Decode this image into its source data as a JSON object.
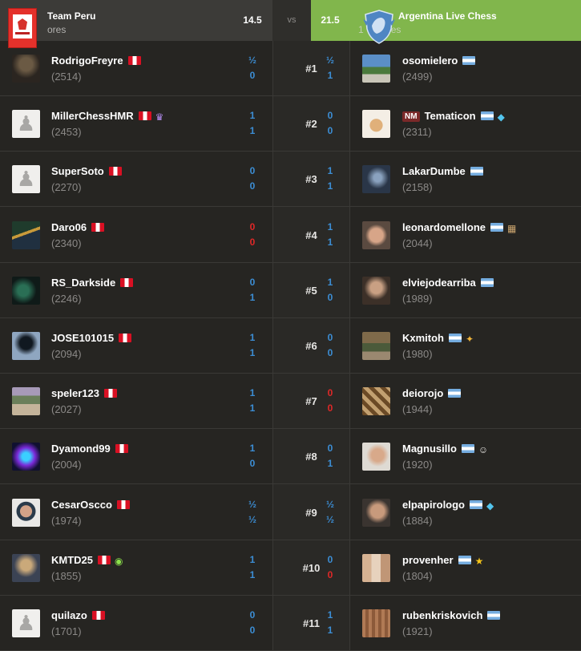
{
  "header": {
    "left_team": "Team Peru",
    "left_sub": "ores",
    "left_score": "14.5",
    "vs": "vs",
    "right_score": "21.5",
    "right_team": "Argentina Live Chess",
    "right_sub": "ores",
    "right_sub_prefix": "1"
  },
  "colors": {
    "win": "#3c8ed5",
    "loss": "#e02828",
    "accent_green": "#81b64c",
    "bg": "#262522"
  },
  "boards": [
    {
      "board": "#1",
      "left": {
        "name": "RodrigoFreyre",
        "rating": "(2514)",
        "avatar": "photo-dark",
        "badges": []
      },
      "left_scores": [
        "½",
        "0"
      ],
      "left_colors": [
        "blue",
        "blue"
      ],
      "right": {
        "name": "osomielero",
        "rating": "(2499)",
        "avatar": "photo-landscape",
        "badges": [],
        "title": ""
      },
      "right_scores": [
        "½",
        "1"
      ],
      "right_colors": [
        "blue",
        "blue"
      ]
    },
    {
      "board": "#2",
      "left": {
        "name": "MillerChessHMR",
        "rating": "(2453)",
        "avatar": "pawn",
        "badges": [
          "crown-icon"
        ]
      },
      "left_scores": [
        "1",
        "1"
      ],
      "left_colors": [
        "blue",
        "blue"
      ],
      "right": {
        "name": "Tematicon",
        "rating": "(2311)",
        "avatar": "photo-dog",
        "badges": [
          "diamond-icon"
        ],
        "title": "NM"
      },
      "right_scores": [
        "0",
        "0"
      ],
      "right_colors": [
        "blue",
        "blue"
      ]
    },
    {
      "board": "#3",
      "left": {
        "name": "SuperSoto",
        "rating": "(2270)",
        "avatar": "pawn",
        "badges": []
      },
      "left_scores": [
        "0",
        "0"
      ],
      "left_colors": [
        "blue",
        "blue"
      ],
      "right": {
        "name": "LakarDumbe",
        "rating": "(2158)",
        "avatar": "photo-dark-figure",
        "badges": [],
        "title": ""
      },
      "right_scores": [
        "1",
        "1"
      ],
      "right_colors": [
        "blue",
        "blue"
      ]
    },
    {
      "board": "#4",
      "left": {
        "name": "Daro06",
        "rating": "(2340)",
        "avatar": "photo-street",
        "badges": []
      },
      "left_scores": [
        "0",
        "0"
      ],
      "left_colors": [
        "red",
        "red"
      ],
      "right": {
        "name": "leonardomellone",
        "rating": "(2044)",
        "avatar": "photo-face",
        "badges": [
          "chessboard-icon"
        ],
        "title": ""
      },
      "right_scores": [
        "1",
        "1"
      ],
      "right_colors": [
        "blue",
        "blue"
      ]
    },
    {
      "board": "#5",
      "left": {
        "name": "RS_Darkside",
        "rating": "(2246)",
        "avatar": "photo-dark-green",
        "badges": []
      },
      "left_scores": [
        "0",
        "1"
      ],
      "left_colors": [
        "blue",
        "blue"
      ],
      "right": {
        "name": "elviejodearriba",
        "rating": "(1989)",
        "avatar": "photo-old-man",
        "badges": [],
        "title": ""
      },
      "right_scores": [
        "1",
        "0"
      ],
      "right_colors": [
        "blue",
        "blue"
      ]
    },
    {
      "board": "#6",
      "left": {
        "name": "JOSE101015",
        "rating": "(2094)",
        "avatar": "photo-hooded",
        "badges": []
      },
      "left_scores": [
        "1",
        "1"
      ],
      "left_colors": [
        "blue",
        "blue"
      ],
      "right": {
        "name": "Kxmitoh",
        "rating": "(1980)",
        "avatar": "photo-room",
        "badges": [
          "bird-icon"
        ],
        "title": ""
      },
      "right_scores": [
        "0",
        "0"
      ],
      "right_colors": [
        "blue",
        "blue"
      ]
    },
    {
      "board": "#7",
      "left": {
        "name": "speler123",
        "rating": "(2027)",
        "avatar": "photo-crowd",
        "badges": []
      },
      "left_scores": [
        "1",
        "1"
      ],
      "left_colors": [
        "blue",
        "blue"
      ],
      "right": {
        "name": "deiorojo",
        "rating": "(1944)",
        "avatar": "photo-chess-board",
        "badges": [],
        "title": ""
      },
      "right_scores": [
        "0",
        "0"
      ],
      "right_colors": [
        "red",
        "red"
      ]
    },
    {
      "board": "#8",
      "left": {
        "name": "Dyamond99",
        "rating": "(2004)",
        "avatar": "photo-neon",
        "badges": []
      },
      "left_scores": [
        "1",
        "0"
      ],
      "left_colors": [
        "blue",
        "blue"
      ],
      "right": {
        "name": "Magnusillo",
        "rating": "(1920)",
        "avatar": "photo-smile",
        "badges": [
          "smiley-icon"
        ],
        "title": ""
      },
      "right_scores": [
        "0",
        "1"
      ],
      "right_colors": [
        "blue",
        "blue"
      ]
    },
    {
      "board": "#9",
      "left": {
        "name": "CesarOscco",
        "rating": "(1974)",
        "avatar": "photo-glasses",
        "badges": []
      },
      "left_scores": [
        "½",
        "½"
      ],
      "left_colors": [
        "blue",
        "blue"
      ],
      "right": {
        "name": "elpapirologo",
        "rating": "(1884)",
        "avatar": "photo-selfie",
        "badges": [
          "diamond-icon"
        ],
        "title": ""
      },
      "right_scores": [
        "½",
        "½"
      ],
      "right_colors": [
        "blue",
        "blue"
      ]
    },
    {
      "board": "#10",
      "left": {
        "name": "KMTD25",
        "rating": "(1855)",
        "avatar": "photo-chess-pieces",
        "badges": [
          "sunglasses-icon"
        ]
      },
      "left_scores": [
        "1",
        "1"
      ],
      "left_colors": [
        "blue",
        "blue"
      ],
      "right": {
        "name": "provenher",
        "rating": "(1804)",
        "avatar": "photo-group",
        "badges": [
          "star-icon"
        ],
        "title": ""
      },
      "right_scores": [
        "0",
        "0"
      ],
      "right_colors": [
        "blue",
        "red"
      ]
    },
    {
      "board": "#11",
      "left": {
        "name": "quilazo",
        "rating": "(1701)",
        "avatar": "pawn",
        "badges": []
      },
      "left_scores": [
        "0",
        "0"
      ],
      "left_colors": [
        "blue",
        "blue"
      ],
      "right": {
        "name": "rubenkriskovich",
        "rating": "(1921)",
        "avatar": "photo-curtain",
        "badges": [],
        "title": ""
      },
      "right_scores": [
        "1",
        "1"
      ],
      "right_colors": [
        "blue",
        "blue"
      ]
    }
  ]
}
